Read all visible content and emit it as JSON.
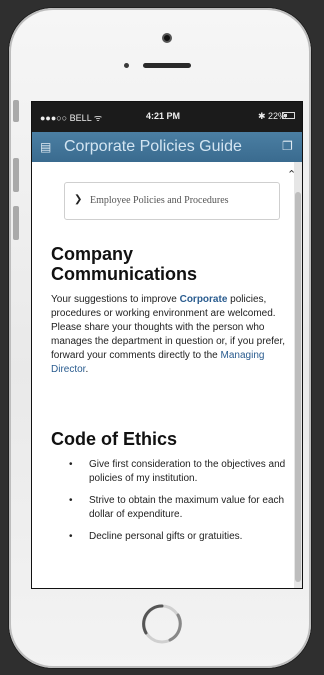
{
  "status": {
    "carrier": "●●●○○ BELL ᯤ",
    "time": "4:21 PM",
    "battery": "✱ 22%"
  },
  "nav": {
    "menu_icon": "menu-icon",
    "title": "Corporate Policies Guide",
    "action_icon": "share-icon"
  },
  "dropdown": {
    "label": "Employee Policies and Procedures"
  },
  "communications": {
    "heading": "Company Communications",
    "p1": "Your suggestions to improve ",
    "p_link1": "Corporate",
    "p2": " policies, procedures or working environment are welcomed. Please share your thoughts with the person who manages the department in question or, if you prefer, forward your comments directly to the ",
    "p_link2": "Managing Director",
    "p3": "."
  },
  "ethics": {
    "heading": "Code of Ethics",
    "items": [
      "Give first consideration to the objectives and policies of my institution.",
      "Strive to obtain the maximum value for each dollar of expenditure.",
      "Decline personal gifts or gratuities."
    ]
  }
}
